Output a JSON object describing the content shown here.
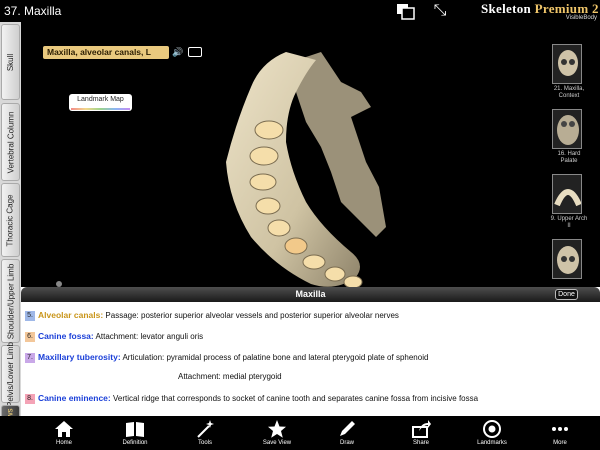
{
  "topbar": {
    "view_title": "37. Maxilla",
    "layers_icon": "layers-icon",
    "expand_icon": "expand-arrows-icon",
    "brand_skeleton": "Skeleton ",
    "brand_premium": "Premium 2",
    "brand_sub": "VisibleBody"
  },
  "left_tabs": [
    {
      "label": "Skull",
      "active": false
    },
    {
      "label": "Vertebral Column",
      "active": false
    },
    {
      "label": "Thoracic Cage",
      "active": false
    },
    {
      "label": "Shoulder/Upper Limb",
      "active": false
    },
    {
      "label": "Pelvis/Lower Limb",
      "active": false
    },
    {
      "label": "My Views",
      "active": true
    }
  ],
  "viewport": {
    "structure_label": "Maxilla, alveolar canals, L",
    "landmark_map_label": "Landmark Map"
  },
  "thumbnails": [
    {
      "caption": "21. Maxilla, Context"
    },
    {
      "caption": "16. Hard Palate"
    },
    {
      "caption": "9. Upper Arch II"
    },
    {
      "caption": ""
    }
  ],
  "panel": {
    "title": "Maxilla",
    "done_label": "Done",
    "entries": [
      {
        "num": "5.",
        "term": "Alveolar canals:",
        "text": " Passage: posterior superior alveolar vessels and posterior superior alveolar nerves",
        "num_color": "#9fb8e8",
        "term_color": "#c9951a"
      },
      {
        "num": "6.",
        "term": "Canine fossa:",
        "text": " Attachment: levator anguli oris",
        "num_color": "#f3c79a",
        "term_color": "#1a3fd8"
      },
      {
        "num": "7.",
        "term": "Maxillary tuberosity:",
        "text": " Articulation: pyramidal process of palatine bone and lateral pterygoid plate of sphenoid",
        "num_color": "#c9a8e8",
        "term_color": "#1a3fd8"
      },
      {
        "num": "",
        "term": "",
        "text": "Attachment: medial pterygoid",
        "num_color": "",
        "term_color": ""
      },
      {
        "num": "8.",
        "term": "Canine eminence:",
        "text": " Vertical ridge that corresponds to socket of canine tooth and separates canine fossa from incisive fossa",
        "num_color": "#f4a3b6",
        "term_color": "#1a3fd8"
      }
    ]
  },
  "toolbar": [
    {
      "label": "Home",
      "icon": "home-icon"
    },
    {
      "label": "Definition",
      "icon": "book-icon"
    },
    {
      "label": "Tools",
      "icon": "wand-icon"
    },
    {
      "label": "Save View",
      "icon": "star-icon"
    },
    {
      "label": "Draw",
      "icon": "pencil-icon"
    },
    {
      "label": "Share",
      "icon": "share-icon"
    },
    {
      "label": "Landmarks",
      "icon": "target-icon"
    },
    {
      "label": "More",
      "icon": "more-dots-icon"
    }
  ],
  "colors": {
    "structure_label_bg": "#e9c97e",
    "active_tab_text": "#f1d27a",
    "bone": "#e7dcc0"
  }
}
